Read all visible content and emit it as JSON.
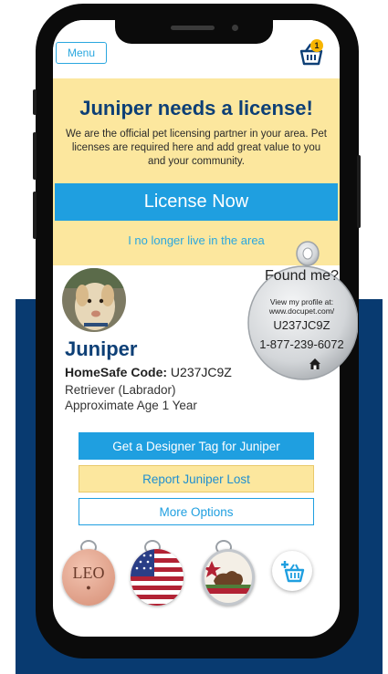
{
  "app": {
    "menu_label": "Menu",
    "cart_count": "1"
  },
  "banner": {
    "title": "Juniper needs a license!",
    "body": "We are the official pet licensing partner in your area. Pet licenses are required here and add great value to you and your community.",
    "license_button": "License Now",
    "no_longer_link": "I no longer live in the area"
  },
  "pet": {
    "name": "Juniper",
    "code_label": "HomeSafe Code:",
    "code_value": "U237JC9Z",
    "breed": "Retriever (Labrador)",
    "age": "Approximate Age 1 Year"
  },
  "actions": {
    "designer_tag": "Get a Designer Tag for Juniper",
    "report_lost": "Report Juniper Lost",
    "more_options": "More Options"
  },
  "tags": [
    {
      "name": "copper-leo-tag",
      "text": "LEO",
      "color": "#e3a48d"
    },
    {
      "name": "american-flag-tag",
      "text": "",
      "color": "#b22234"
    },
    {
      "name": "california-bear-tag",
      "text": "",
      "color": "#f4efe6"
    }
  ],
  "floating_tag": {
    "title": "Found me?",
    "line1": "View my profile at:",
    "line2": "www.docupet.com/",
    "code": "U237JC9Z",
    "phone": "1-877-239-6072",
    "icon": "home-icon"
  },
  "colors": {
    "navy": "#083a70",
    "accent": "#1f9fe0",
    "banner": "#fce79e",
    "title": "#0d3f76"
  }
}
